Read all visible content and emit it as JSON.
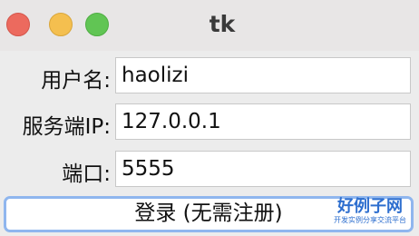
{
  "window": {
    "title": "tk"
  },
  "form": {
    "username": {
      "label": "用户名:",
      "value": "haolizi"
    },
    "server_ip": {
      "label": "服务端IP:",
      "value": "127.0.0.1"
    },
    "port": {
      "label": "端口:",
      "value": "5555"
    }
  },
  "login_button": {
    "label": "登录 (无需注册)"
  },
  "logo": {
    "main": "好例子网",
    "sub": "开发实例分享交流平台"
  },
  "colors": {
    "close": "#ec6a5e",
    "minimize": "#f4bf4f",
    "maximize": "#61c554",
    "button_focus": "#8fb6ee"
  }
}
